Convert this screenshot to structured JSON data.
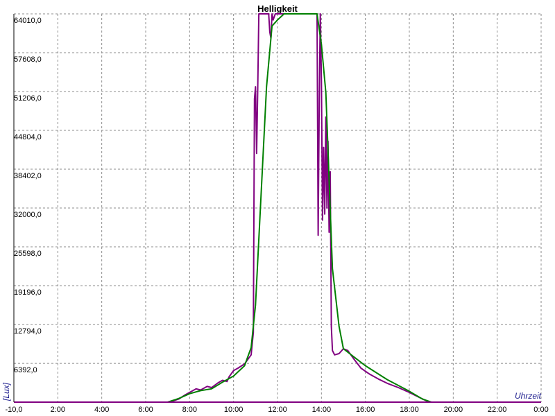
{
  "chart_data": {
    "type": "line",
    "title": "Helligkeit",
    "xlabel": "Uhrzeit",
    "ylabel": "[Lux]",
    "xlim": [
      0,
      24
    ],
    "ylim": [
      0,
      64010
    ],
    "grid": true,
    "x_tick_labels": [
      "-10,0",
      "2:00",
      "4:00",
      "6:00",
      "8:00",
      "10:00",
      "12:00",
      "14:00",
      "16:00",
      "18:00",
      "20:00",
      "22:00",
      "0:00"
    ],
    "y_tick_labels": [
      "6392,0",
      "12794,0",
      "19196,0",
      "25598,0",
      "32000,0",
      "38402,0",
      "44804,0",
      "51206,0",
      "57608,0",
      "64010,0"
    ],
    "y_tick_values": [
      6392,
      12794,
      19196,
      25598,
      32000,
      38402,
      44804,
      51206,
      57608,
      64010
    ],
    "series": [
      {
        "color": "#800080",
        "points": [
          [
            0,
            0
          ],
          [
            7.0,
            0
          ],
          [
            7.2,
            150
          ],
          [
            7.5,
            500
          ],
          [
            7.8,
            1200
          ],
          [
            8.0,
            1600
          ],
          [
            8.3,
            2200
          ],
          [
            8.5,
            2000
          ],
          [
            8.8,
            2600
          ],
          [
            9.0,
            2400
          ],
          [
            9.3,
            3200
          ],
          [
            9.5,
            3600
          ],
          [
            9.7,
            3400
          ],
          [
            9.8,
            4200
          ],
          [
            10.0,
            5200
          ],
          [
            10.2,
            5600
          ],
          [
            10.5,
            6300
          ],
          [
            10.8,
            7800
          ],
          [
            10.9,
            11500
          ],
          [
            10.95,
            50000
          ],
          [
            11.0,
            52000
          ],
          [
            11.05,
            41000
          ],
          [
            11.1,
            51500
          ],
          [
            11.15,
            64010
          ],
          [
            11.6,
            64010
          ],
          [
            11.65,
            61000
          ],
          [
            11.7,
            60000
          ],
          [
            11.75,
            64010
          ],
          [
            11.8,
            63000
          ],
          [
            11.9,
            64010
          ],
          [
            13.8,
            64010
          ],
          [
            13.85,
            27500
          ],
          [
            13.9,
            50000
          ],
          [
            13.95,
            64010
          ],
          [
            14.0,
            53000
          ],
          [
            14.05,
            30000
          ],
          [
            14.1,
            42000
          ],
          [
            14.15,
            31000
          ],
          [
            14.2,
            47000
          ],
          [
            14.25,
            32000
          ],
          [
            14.3,
            43000
          ],
          [
            14.35,
            28000
          ],
          [
            14.4,
            38000
          ],
          [
            14.45,
            12500
          ],
          [
            14.5,
            8500
          ],
          [
            14.6,
            7800
          ],
          [
            14.8,
            8000
          ],
          [
            15.0,
            8800
          ],
          [
            15.2,
            8500
          ],
          [
            15.5,
            7000
          ],
          [
            15.8,
            5600
          ],
          [
            16.2,
            4600
          ],
          [
            16.6,
            3800
          ],
          [
            17.0,
            3100
          ],
          [
            17.5,
            2400
          ],
          [
            18.0,
            1600
          ],
          [
            18.5,
            700
          ],
          [
            18.8,
            200
          ],
          [
            19.0,
            0
          ],
          [
            24.0,
            0
          ]
        ]
      },
      {
        "color": "#008000",
        "points": [
          [
            0,
            0
          ],
          [
            7.0,
            0
          ],
          [
            7.5,
            600
          ],
          [
            8.0,
            1400
          ],
          [
            8.5,
            1900
          ],
          [
            9.0,
            2200
          ],
          [
            9.5,
            3300
          ],
          [
            10.0,
            4300
          ],
          [
            10.5,
            6000
          ],
          [
            10.8,
            9000
          ],
          [
            11.0,
            16000
          ],
          [
            11.5,
            52000
          ],
          [
            11.75,
            62000
          ],
          [
            12.0,
            63000
          ],
          [
            12.3,
            64010
          ],
          [
            13.8,
            64010
          ],
          [
            14.0,
            59000
          ],
          [
            14.2,
            51000
          ],
          [
            14.5,
            22000
          ],
          [
            14.8,
            12500
          ],
          [
            15.0,
            8800
          ],
          [
            15.5,
            7400
          ],
          [
            16.0,
            6000
          ],
          [
            17.0,
            3700
          ],
          [
            18.0,
            1800
          ],
          [
            18.6,
            500
          ],
          [
            19.0,
            0
          ],
          [
            24.0,
            0
          ]
        ]
      }
    ]
  }
}
